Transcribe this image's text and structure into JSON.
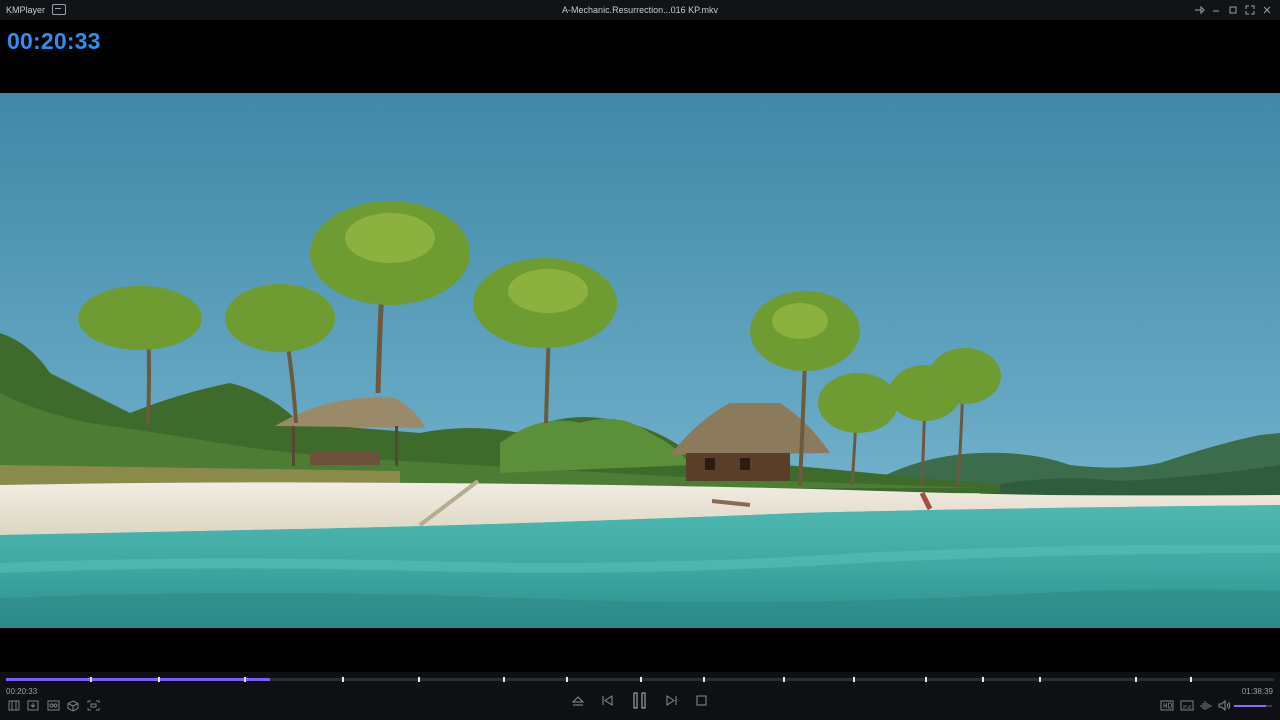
{
  "window": {
    "app_name": "KMPlayer",
    "file_title": "A-Mechanic.Resurrection...016 KP.mkv"
  },
  "osd": {
    "time": "00:20:33"
  },
  "playback": {
    "elapsed": "00:20:33",
    "duration": "01:38:39",
    "progress_fraction": 0.2084,
    "chapter_fractions": [
      0.066,
      0.12,
      0.188,
      0.265,
      0.325,
      0.392,
      0.442,
      0.5,
      0.55,
      0.613,
      0.668,
      0.725,
      0.77,
      0.815,
      0.89,
      0.934
    ],
    "volume_fraction": 0.85
  },
  "colors": {
    "accent": "#7b5cff",
    "osd_time": "#2f8ff0"
  },
  "icons": {
    "left_controls": [
      "playlist-icon",
      "capture-icon",
      "vr-icon",
      "3d-icon",
      "screen-ratio-icon"
    ],
    "center_controls": [
      "eject-icon",
      "previous-icon",
      "pause-icon",
      "next-icon",
      "stop-icon"
    ],
    "right_controls": [
      "hd-icon",
      "subtitle-icon",
      "equalizer-icon",
      "volume-icon"
    ],
    "window_controls": [
      "pin-icon",
      "minimize-icon",
      "maximize-icon",
      "fullscreen-icon",
      "close-icon"
    ]
  }
}
